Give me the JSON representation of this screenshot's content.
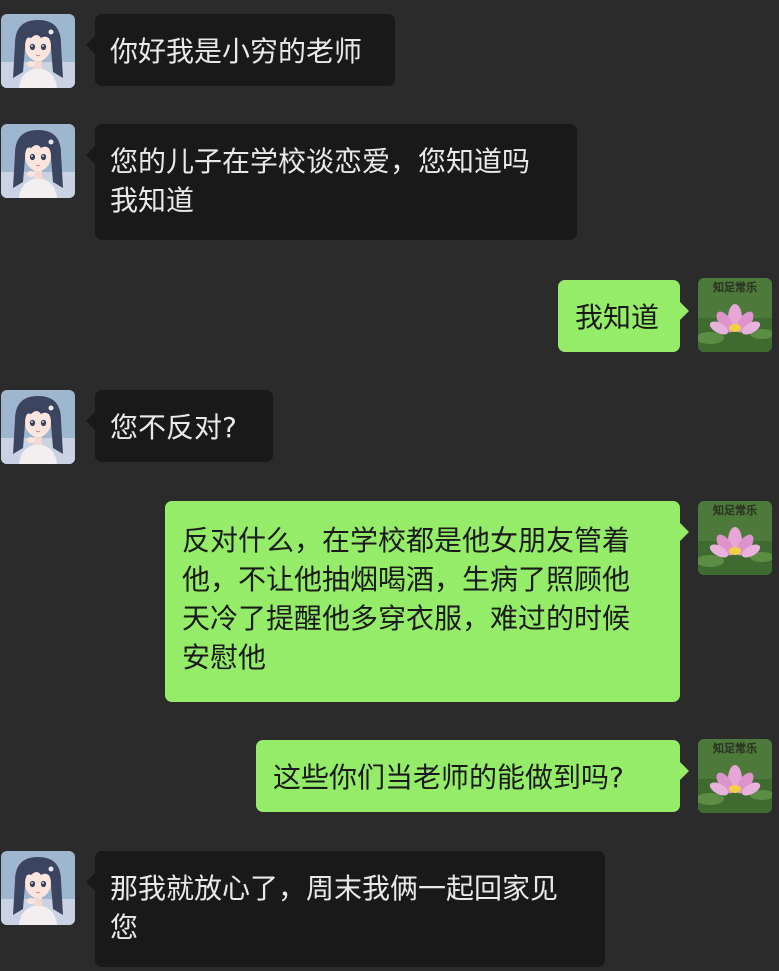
{
  "chat": {
    "messages": [
      {
        "side": "in",
        "text": "你好我是小穷的老师"
      },
      {
        "side": "in",
        "text": "您的儿子在学校谈恋爱，您知道吗\n我知道"
      },
      {
        "side": "out",
        "text": "我知道"
      },
      {
        "side": "in",
        "text": "您不反对?"
      },
      {
        "side": "out",
        "text": "反对什么，在学校都是他女朋友管着\n他，不让他抽烟喝酒，生病了照顾他\n天冷了提醒他多穿衣服，难过的时候\n安慰他"
      },
      {
        "side": "out",
        "text": "这些你们当老师的能做到吗?"
      },
      {
        "side": "in",
        "text": "那我就放心了，周末我俩一起回家见\n您"
      }
    ],
    "my_avatar_caption": "知足常乐",
    "colors": {
      "background": "#2b2b2b",
      "incoming_bubble": "#191919",
      "outgoing_bubble": "#95ec69"
    },
    "icons": {
      "contact_avatar": "anime-girl-avatar-icon",
      "my_avatar": "lotus-flower-avatar-icon"
    }
  }
}
